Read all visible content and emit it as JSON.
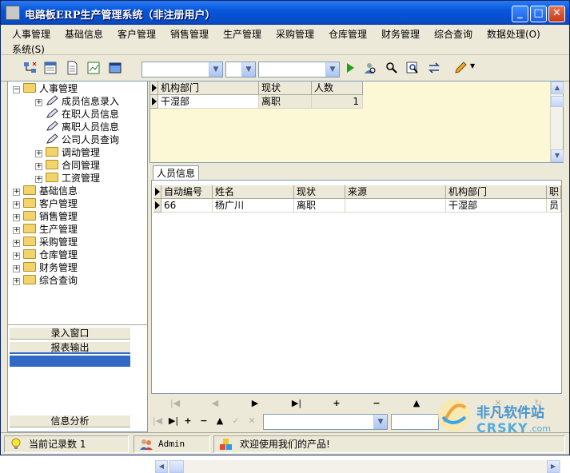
{
  "window": {
    "title": "电路板ERP生产管理系统（非注册用户）"
  },
  "menu": [
    "人事管理",
    "基础信息",
    "客户管理",
    "销售管理",
    "生产管理",
    "采购管理",
    "仓库管理",
    "财务管理",
    "综合查询",
    "数据处理(O)",
    "系统(S)"
  ],
  "tree": {
    "root": "人事管理",
    "children": [
      "成员信息录入",
      "在职人员信息",
      "离职人员信息",
      "公司人员查询",
      "调动管理",
      "合同管理",
      "工资管理"
    ],
    "modules": [
      "基础信息",
      "客户管理",
      "销售管理",
      "生产管理",
      "采购管理",
      "仓库管理",
      "财务管理",
      "综合查询"
    ]
  },
  "left_buttons": {
    "entry": "录入窗口",
    "report": "报表输出",
    "analysis": "信息分析"
  },
  "summary_grid": {
    "columns": [
      "机构部门",
      "现状",
      "人数"
    ],
    "rows": [
      [
        "干湿部",
        "离职",
        "1"
      ]
    ]
  },
  "tab_label": "人员信息",
  "detail_grid": {
    "columns": [
      "自动编号",
      "姓名",
      "现状",
      "来源",
      "机构部门",
      "职"
    ],
    "rows": [
      [
        "66",
        "杨广川",
        "离职",
        "",
        "干湿部",
        "员"
      ]
    ]
  },
  "status": {
    "record_count": "当前记录数 1",
    "user": "Admin",
    "welcome": "欢迎使用我们的产品!"
  },
  "watermark": {
    "brand": "非凡软件站",
    "site": "CRSKY",
    "domain": ".com"
  },
  "colors": {
    "title_blue": "#0556dc",
    "selection_blue": "#316ac5",
    "grid_yellow": "#fcf8d5"
  }
}
